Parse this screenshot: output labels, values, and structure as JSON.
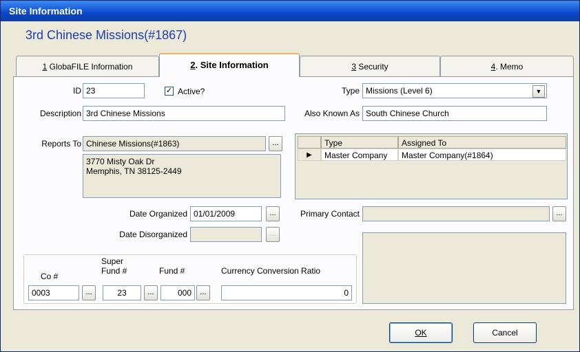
{
  "window": {
    "title": "Site Information"
  },
  "heading": "3rd Chinese Missions(#1867)",
  "tabs": [
    {
      "key": "1",
      "label": " GlobaFILE Information"
    },
    {
      "key": "2",
      "label": ". Site Information"
    },
    {
      "key": "3",
      "label": " Security"
    },
    {
      "key": "4",
      "label": ". Memo"
    }
  ],
  "form": {
    "id_label": "ID",
    "id_value": "23",
    "active_label": "Active?",
    "active_checked": true,
    "type_label": "Type",
    "type_value": "Missions (Level 6)",
    "description_label": "Description",
    "description_value": "3rd Chinese Missions",
    "aka_label": "Also Known As",
    "aka_value": "South Chinese Church",
    "reports_to_label": "Reports To",
    "reports_to_value": "Chinese Missions(#1863)",
    "address_line1": "3770 Misty Oak Dr",
    "address_line2": "Memphis, TN   38125-2449",
    "date_organized_label": "Date Organized",
    "date_organized_value": "01/01/2009",
    "date_disorganized_label": "Date Disorganized",
    "date_disorganized_value": "",
    "primary_contact_label": "Primary Contact",
    "primary_contact_value": "",
    "dots": "..."
  },
  "grid": {
    "columns": [
      "Type",
      "Assigned To"
    ],
    "rows": [
      {
        "type": "Master Company",
        "assigned_to": "Master Company(#1864)"
      }
    ]
  },
  "funds": {
    "co_label": "Co #",
    "super_label_1": "Super",
    "super_label_2": "Fund #",
    "fund_label": "Fund #",
    "ratio_label": "Currency Conversion Ratio",
    "co_value": "0003",
    "super_value": "23",
    "fund_value": "000",
    "ratio_value": "0"
  },
  "footer": {
    "ok_label": "OK",
    "cancel_label": "Cancel"
  }
}
